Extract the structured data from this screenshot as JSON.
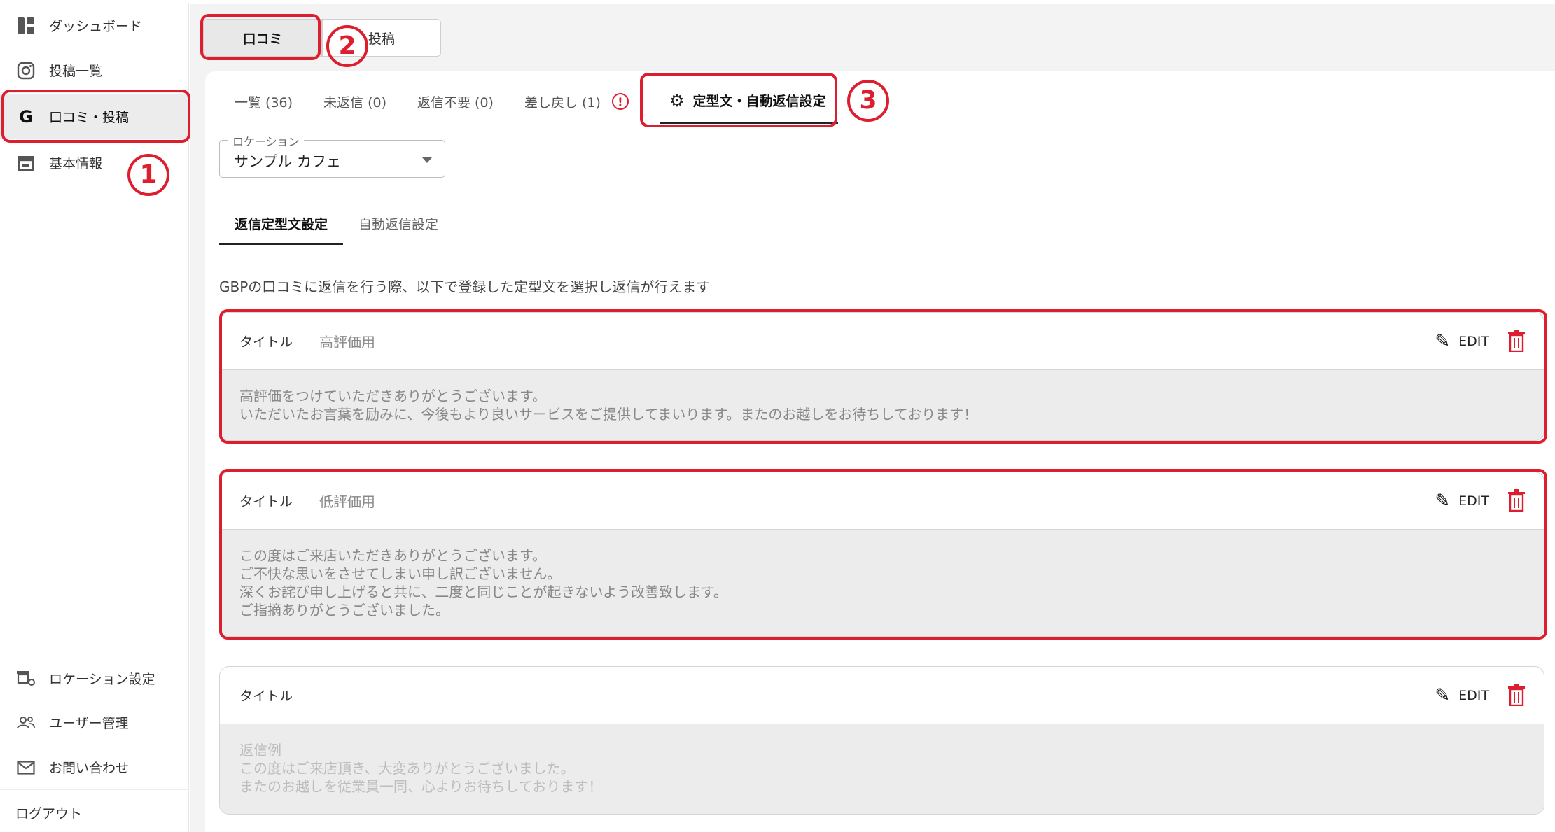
{
  "sidebar": {
    "top_items": [
      {
        "label": "ダッシュボード",
        "icon": "dashboard-icon"
      },
      {
        "label": "投稿一覧",
        "icon": "instagram-icon"
      },
      {
        "label": "口コミ・投稿",
        "icon": "google-g-icon"
      },
      {
        "label": "基本情報",
        "icon": "store-icon"
      }
    ],
    "bottom_items": [
      {
        "label": "ロケーション設定",
        "icon": "location-settings-icon"
      },
      {
        "label": "ユーザー管理",
        "icon": "users-icon"
      },
      {
        "label": "お問い合わせ",
        "icon": "mail-icon"
      },
      {
        "label": "ログアウト"
      }
    ]
  },
  "toggle": {
    "reviews": "口コミ",
    "posts": "投稿"
  },
  "tabs": {
    "all": "一覧 (36)",
    "unreplied": "未返信 (0)",
    "no_reply": "返信不要 (0)",
    "returned": "差し戻し (1)",
    "settings": "定型文・自動返信設定"
  },
  "location": {
    "legend": "ロケーション",
    "value": "サンプル カフェ"
  },
  "subtabs": {
    "templates": "返信定型文設定",
    "auto": "自動返信設定"
  },
  "description": "GBPの口コミに返信を行う際、以下で登録した定型文を選択し返信が行えます",
  "templates": [
    {
      "title_label": "タイトル",
      "title": "高評価用",
      "edit": "EDIT",
      "lines": [
        "高評価をつけていただきありがとうございます。",
        "いただいたお言葉を励みに、今後もより良いサービスをご提供してまいります。またのお越しをお待ちしております！"
      ]
    },
    {
      "title_label": "タイトル",
      "title": "低評価用",
      "edit": "EDIT",
      "lines": [
        "この度はご来店いただきありがとうございます。",
        "ご不快な思いをさせてしまい申し訳ございません。",
        "深くお詫び申し上げると共に、二度と同じことが起きないよう改善致します。",
        "ご指摘ありがとうございました。"
      ]
    },
    {
      "title_label": "タイトル",
      "title": "",
      "edit": "EDIT",
      "lines": [
        "返信例",
        "この度はご来店頂き、大変ありがとうございました。",
        "またのお越しを従業員一同、心よりお待ちしております！"
      ]
    }
  ],
  "annotations": {
    "one": "1",
    "two": "2",
    "three": "3"
  },
  "colors": {
    "accent_red": "#dd1e2f"
  }
}
